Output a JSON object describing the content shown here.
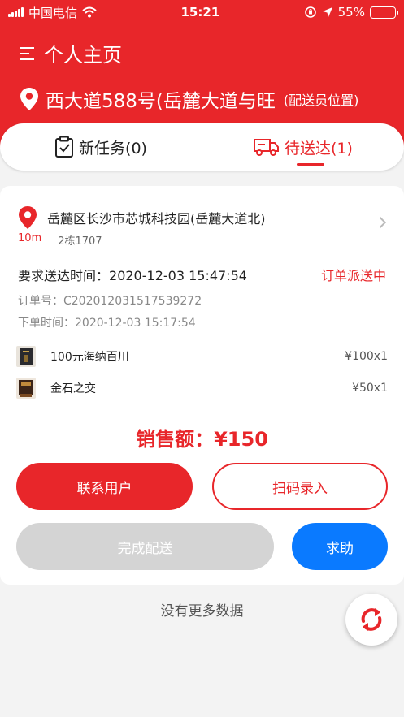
{
  "status_bar": {
    "carrier": "中国电信",
    "time": "15:21",
    "battery": "55%"
  },
  "header": {
    "title": "个人主页",
    "address": "西大道588号(岳麓大道与旺",
    "address_note": "(配送员位置)"
  },
  "tabs": [
    {
      "label": "新任务(0)",
      "icon": "clipboard-check-icon",
      "active": false
    },
    {
      "label": "待送达(1)",
      "icon": "delivery-truck-icon",
      "active": true
    }
  ],
  "order": {
    "destination": "岳麓区长沙市芯城科技园(岳麓大道北)",
    "distance": "10m",
    "building": "2栋1707",
    "deliver_time_label": "要求送达时间：",
    "deliver_time": "2020-12-03 15:47:54",
    "status": "订单派送中",
    "order_no_label": "订单号：",
    "order_no": "C202012031517539272",
    "order_time_label": "下单时间：",
    "order_time": "2020-12-03 15:17:54",
    "items": [
      {
        "name": "100元海纳百川",
        "price": "¥100x1"
      },
      {
        "name": "金石之交",
        "price": "¥50x1"
      }
    ],
    "sales_label": "销售额：",
    "sales_amount": "¥150"
  },
  "buttons": {
    "contact": "联系用户",
    "scan": "扫码录入",
    "complete": "完成配送",
    "help": "求助"
  },
  "footer": {
    "no_more": "没有更多数据"
  },
  "colors": {
    "brand_red": "#e8262a",
    "help_blue": "#0a7aff",
    "disabled_gray": "#d4d4d4"
  }
}
